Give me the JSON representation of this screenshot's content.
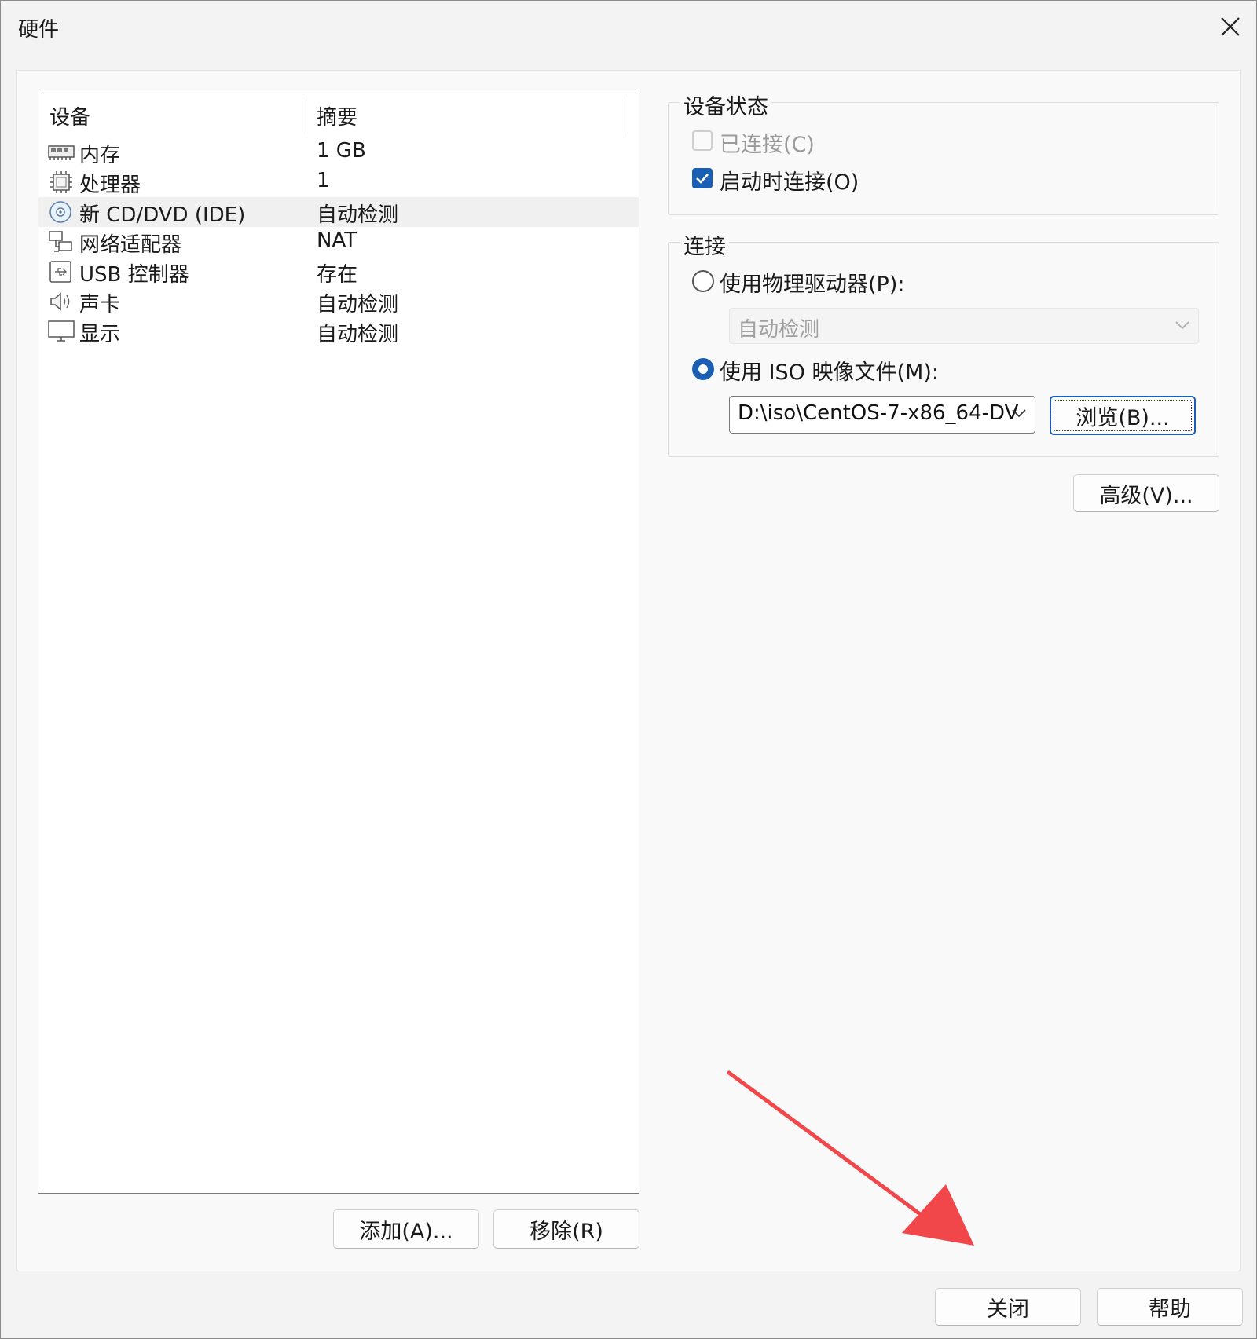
{
  "window": {
    "title": "硬件"
  },
  "device_list": {
    "columns": [
      "设备",
      "摘要"
    ],
    "rows": [
      {
        "name": "内存",
        "summary": "1 GB",
        "icon": "memory-icon"
      },
      {
        "name": "处理器",
        "summary": "1",
        "icon": "processor-icon"
      },
      {
        "name": "新 CD/DVD (IDE)",
        "summary": "自动检测",
        "icon": "cd-dvd-icon",
        "selected": true
      },
      {
        "name": "网络适配器",
        "summary": "NAT",
        "icon": "network-adapter-icon"
      },
      {
        "name": "USB 控制器",
        "summary": "存在",
        "icon": "usb-controller-icon"
      },
      {
        "name": "声卡",
        "summary": "自动检测",
        "icon": "sound-card-icon"
      },
      {
        "name": "显示",
        "summary": "自动检测",
        "icon": "display-icon"
      }
    ],
    "add_button": "添加(A)...",
    "remove_button": "移除(R)"
  },
  "device_status": {
    "title": "设备状态",
    "connected_label": "已连接(C)",
    "connected_checked": false,
    "connected_enabled": false,
    "connect_at_power_on_label": "启动时连接(O)",
    "connect_at_power_on_checked": true
  },
  "connection": {
    "title": "连接",
    "physical_drive_label": "使用物理驱动器(P):",
    "physical_drive_value": "自动检测",
    "iso_label": "使用 ISO 映像文件(M):",
    "iso_value": "D:\\iso\\CentOS-7-x86_64-DV",
    "selected": "iso",
    "browse_button": "浏览(B)..."
  },
  "advanced_button": "高级(V)...",
  "footer": {
    "close_button": "关闭",
    "help_button": "帮助"
  },
  "colors": {
    "accent": "#1a5fb4",
    "annotation_arrow": "#f2474a"
  }
}
